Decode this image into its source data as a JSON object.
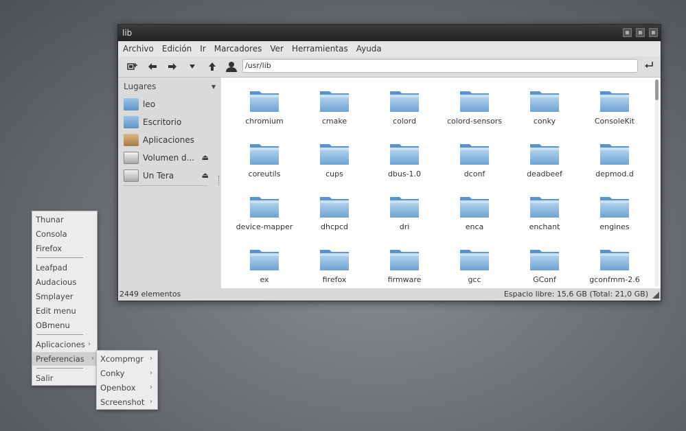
{
  "window": {
    "title": "lib",
    "menubar": [
      "Archivo",
      "Edición",
      "Ir",
      "Marcadores",
      "Ver",
      "Herramientas",
      "Ayuda"
    ],
    "toolbar_icons": [
      "new-window-icon",
      "back-arrow-icon",
      "forward-arrow-icon",
      "history-dropdown-icon",
      "up-arrow-icon"
    ],
    "address": {
      "path": "/usr/lib"
    }
  },
  "sidebar": {
    "header": "Lugares",
    "places": [
      {
        "label": "leo",
        "icon": "home-folder-icon",
        "color": "#6a9bc8"
      },
      {
        "label": "Escritorio",
        "icon": "desktop-folder-icon",
        "color": "#6a9bc8"
      },
      {
        "label": "Aplicaciones",
        "icon": "applications-icon",
        "color": "#c8a060"
      },
      {
        "label": "Volumen d...",
        "icon": "drive-icon",
        "color": "#bdbdbd",
        "eject": true
      },
      {
        "label": "Un Tera",
        "icon": "drive-icon",
        "color": "#bdbdbd",
        "eject": true
      }
    ]
  },
  "files": [
    "chromium",
    "cmake",
    "colord",
    "colord-sensors",
    "conky",
    "ConsoleKit",
    "coreutils",
    "cups",
    "dbus-1.0",
    "dconf",
    "deadbeef",
    "depmod.d",
    "device-mapper",
    "dhcpcd",
    "dri",
    "enca",
    "enchant",
    "engines",
    "ex",
    "firefox",
    "firmware",
    "gcc",
    "GConf",
    "gconfmm-2.6"
  ],
  "status": {
    "count": "2449 elementos",
    "free": "Espacio libre: 15,6 GB (Total: 21,0 GB)"
  },
  "menu_main": {
    "items": [
      "Thunar",
      "Consola",
      "Firefox",
      "Leafpad",
      "Audacious",
      "Smplayer",
      "Edit menu",
      "OBmenu",
      "Aplicaciones",
      "Preferencias",
      "Salir"
    ],
    "active": "Preferencias"
  },
  "menu_sub": {
    "items": [
      "Xcompmgr",
      "Conky",
      "Openbox",
      "Screenshot"
    ]
  },
  "colors": {
    "folder": "#7fb0db",
    "accent": "#cfcfcf"
  }
}
